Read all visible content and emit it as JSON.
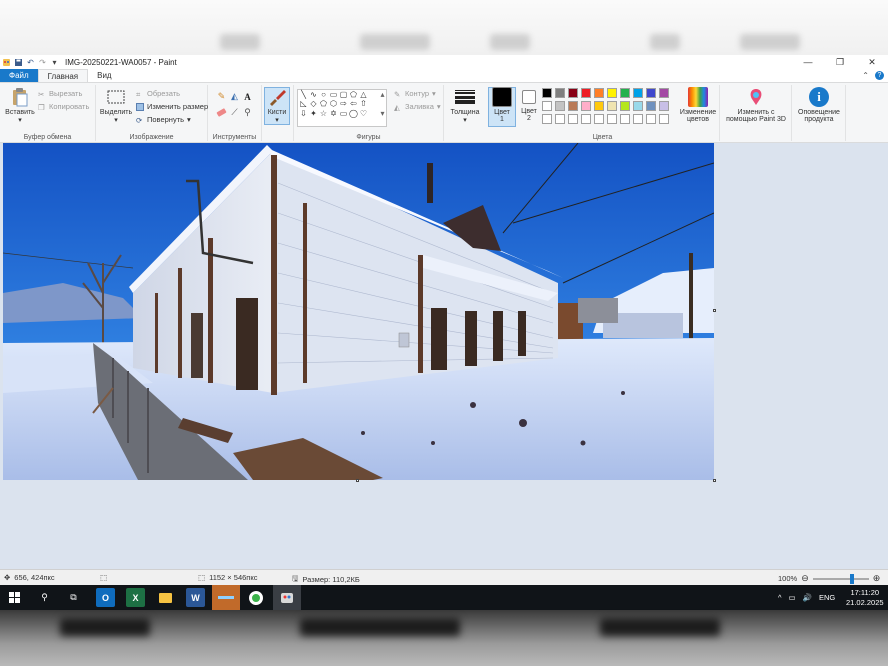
{
  "window": {
    "title": "IMG-20250221-WA0057 - Paint",
    "controls": {
      "minimize": "—",
      "maximize": "❐",
      "close": "✕"
    }
  },
  "tabs": {
    "file": "Файл",
    "home": "Главная",
    "view": "Вид"
  },
  "ribbon": {
    "clipboard": {
      "paste": "Вставить",
      "cut": "Вырезать",
      "copy": "Копировать",
      "label": "Буфер обмена"
    },
    "image": {
      "select": "Выделить",
      "crop": "Обрезать",
      "resize": "Изменить размер",
      "rotate": "Повернуть",
      "label": "Изображение"
    },
    "tools": {
      "label": "Инструменты"
    },
    "brushes": {
      "label": "Кисти"
    },
    "shapes": {
      "outline": "Контур",
      "fill": "Заливка",
      "label": "Фигуры"
    },
    "size": {
      "label": "Толщина"
    },
    "color1": {
      "line1": "Цвет",
      "line2": "1"
    },
    "color2": {
      "line1": "Цвет",
      "line2": "2"
    },
    "colors": {
      "label": "Цвета"
    },
    "edit_colors": {
      "line1": "Изменение",
      "line2": "цветов"
    },
    "paint3d": {
      "line1": "Изменить с",
      "line2": "помощью Paint 3D"
    },
    "product_alert": {
      "line1": "Оповещение",
      "line2": "продукта"
    }
  },
  "palette": {
    "row1": [
      "#000000",
      "#7f7f7f",
      "#880015",
      "#ed1c24",
      "#ff7f27",
      "#fff200",
      "#22b14c",
      "#00a2e8",
      "#3f48cc",
      "#a349a4"
    ],
    "row2": [
      "#ffffff",
      "#c3c3c3",
      "#b97a57",
      "#ffaec9",
      "#ffc90e",
      "#efe4b0",
      "#b5e61d",
      "#99d9ea",
      "#7092be",
      "#c8bfe7"
    ],
    "row3_count": 10
  },
  "status": {
    "cursor": "656, 424пкс",
    "dimensions": "1152 × 546пкс",
    "file_size": "Размер: 110,2КБ",
    "zoom": "100%",
    "zoom_fraction": 0.72
  },
  "taskbar": {
    "tray_lang": "ENG",
    "time": "17:11:20",
    "date": "21.02.2025"
  },
  "icons": {
    "app": "paint-icon",
    "save": "save-icon",
    "undo": "undo-icon",
    "redo": "redo-icon",
    "start": "windows-start-icon",
    "search": "search-icon",
    "taskview": "task-view-icon"
  }
}
